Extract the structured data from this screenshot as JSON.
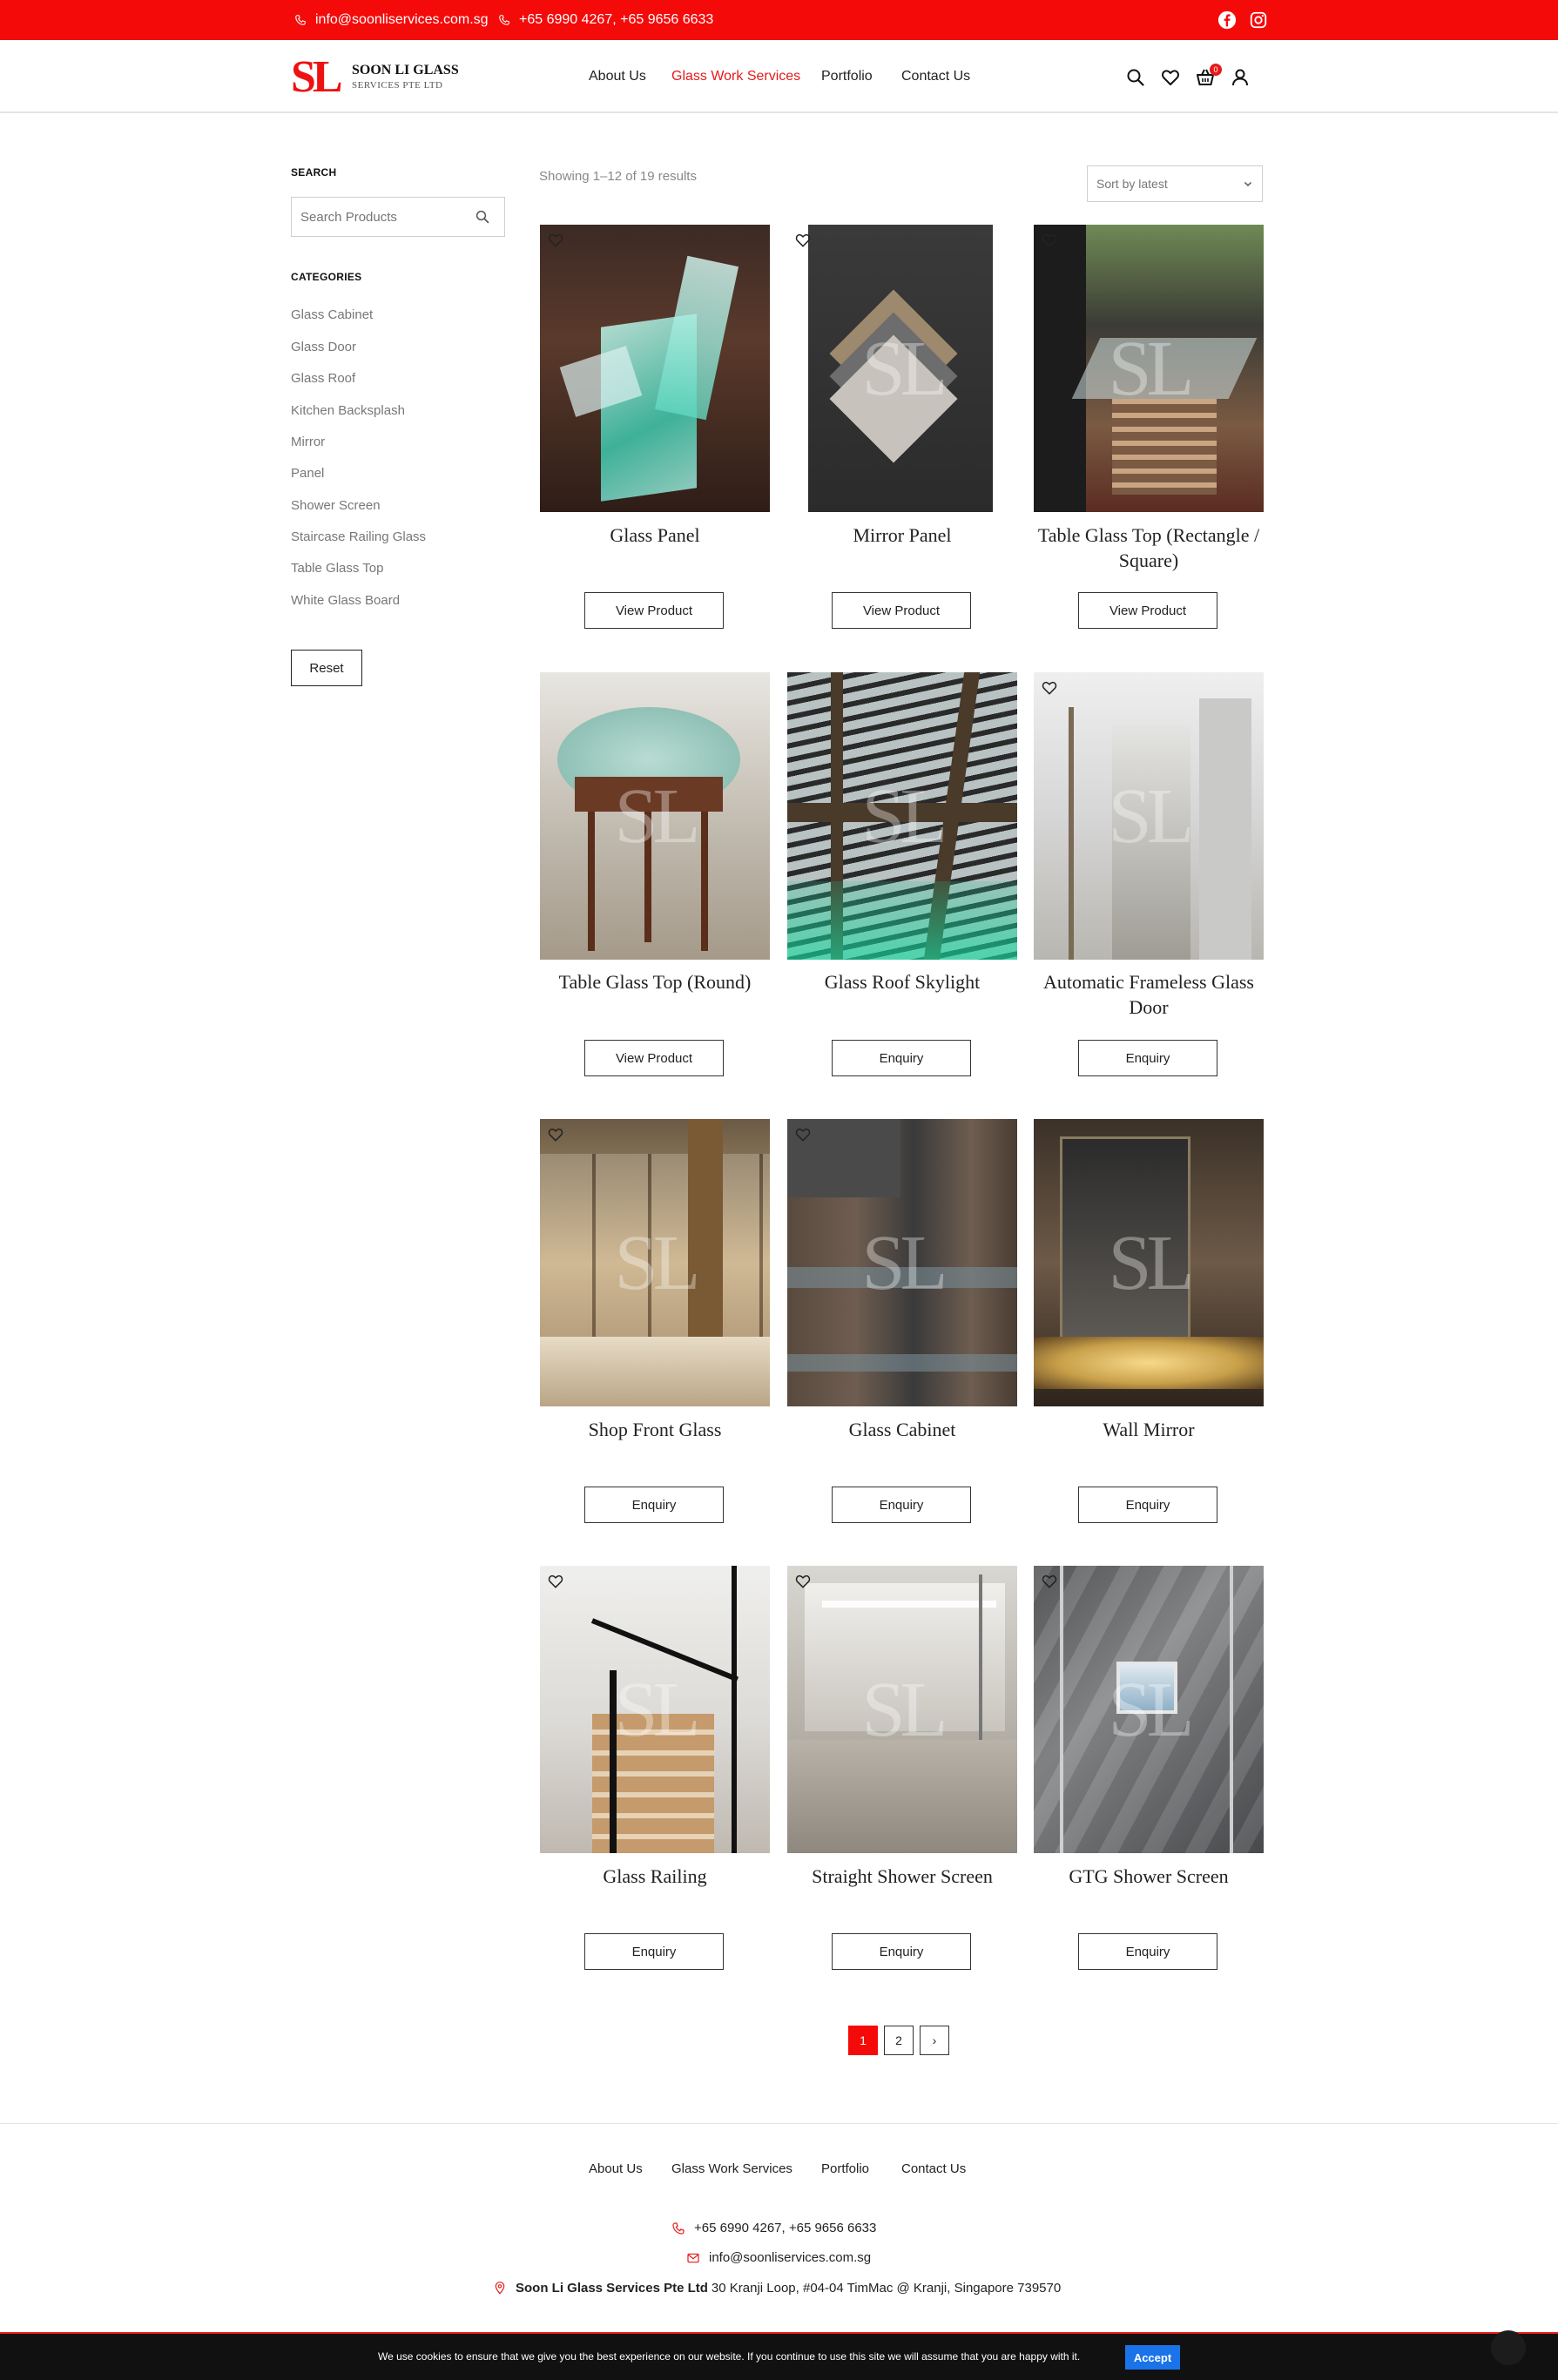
{
  "topbar": {
    "email": "info@soonliservices.com.sg",
    "phone": "+65 6990 4267, +65 9656 6633",
    "social": [
      "facebook-icon",
      "instagram-icon"
    ]
  },
  "brand": {
    "mark": "SL",
    "name": "SOON LI GLASS",
    "sub": "SERVICES PTE LTD",
    "accent_color": "#f50a0a"
  },
  "nav": [
    {
      "label": "About Us",
      "active": false
    },
    {
      "label": "Glass Work Services",
      "active": true
    },
    {
      "label": "Portfolio",
      "active": false
    },
    {
      "label": "Contact Us",
      "active": false
    }
  ],
  "header_icons": [
    "search-icon",
    "heart-icon",
    "cart-icon",
    "user-icon"
  ],
  "cart_count": "0",
  "sidebar": {
    "search_heading": "SEARCH",
    "search_placeholder": "Search Products",
    "categories_heading": "CATEGORIES",
    "categories": [
      "Glass Cabinet",
      "Glass Door",
      "Glass Roof",
      "Kitchen Backsplash",
      "Mirror",
      "Panel",
      "Shower Screen",
      "Staircase Railing Glass",
      "Table Glass Top",
      "White Glass Board"
    ],
    "reset_label": "Reset"
  },
  "results": {
    "count_text": "Showing 1–12 of 19 results",
    "sort_label": "Sort by latest"
  },
  "watermark": "SL",
  "products": [
    {
      "title": "Glass Panel",
      "button": "View Product"
    },
    {
      "title": "Mirror Panel",
      "button": "View Product"
    },
    {
      "title": "Table Glass Top (Rectangle / Square)",
      "button": "View Product"
    },
    {
      "title": "Table Glass Top (Round)",
      "button": "View Product"
    },
    {
      "title": "Glass Roof Skylight",
      "button": "Enquiry"
    },
    {
      "title": "Automatic Frameless Glass Door",
      "button": "Enquiry"
    },
    {
      "title": "Shop Front Glass",
      "button": "Enquiry"
    },
    {
      "title": "Glass Cabinet",
      "button": "Enquiry"
    },
    {
      "title": "Wall Mirror",
      "button": "Enquiry"
    },
    {
      "title": "Glass Railing",
      "button": "Enquiry"
    },
    {
      "title": "Straight Shower Screen",
      "button": "Enquiry"
    },
    {
      "title": "GTG Shower Screen",
      "button": "Enquiry"
    }
  ],
  "pagination": {
    "pages": [
      "1",
      "2"
    ],
    "current": "1",
    "next": "›"
  },
  "footer": {
    "nav": [
      "About Us",
      "Glass Work Services",
      "Portfolio",
      "Contact Us"
    ],
    "phone": "+65 6990 4267, +65 9656 6633",
    "email": "info@soonliservices.com.sg",
    "company": "Soon Li Glass Services Pte Ltd",
    "address": "30 Kranji Loop, #04-04 TimMac @ Kranji, Singapore 739570"
  },
  "cookie": {
    "text": "We use cookies to ensure that we give you the best experience on our website. If you continue to use this site we will assume that you are happy with it.",
    "accept_label": "Accept"
  }
}
